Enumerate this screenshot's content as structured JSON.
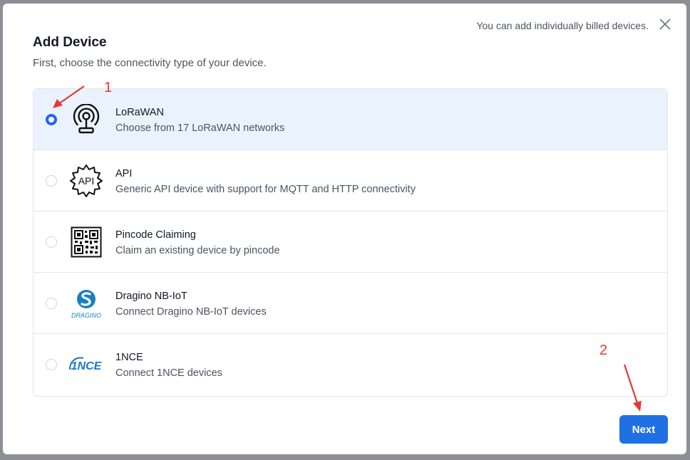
{
  "dialog": {
    "title": "Add Device",
    "subtitle": "First, choose the connectivity type of your device.",
    "hint": "You can add individually billed devices.",
    "close_icon": "close-icon",
    "next_label": "Next"
  },
  "options": [
    {
      "id": "lorawan",
      "title": "LoRaWAN",
      "description": "Choose from 17 LoRaWAN networks",
      "icon": "lorawan-antenna-icon",
      "selected": true
    },
    {
      "id": "api",
      "title": "API",
      "description": "Generic API device with support for MQTT and HTTP connectivity",
      "icon": "api-gear-icon",
      "selected": false
    },
    {
      "id": "pincode",
      "title": "Pincode Claiming",
      "description": "Claim an existing device by pincode",
      "icon": "qr-code-icon",
      "selected": false
    },
    {
      "id": "dragino",
      "title": "Dragino NB-IoT",
      "description": "Connect Dragino NB-IoT devices",
      "icon": "dragino-logo-icon",
      "selected": false
    },
    {
      "id": "1nce",
      "title": "1NCE",
      "description": "Connect 1NCE devices",
      "icon": "1nce-logo-icon",
      "selected": false
    }
  ],
  "logos": {
    "api_text": "API",
    "dragino_text": "DRAGINO",
    "one_nce_text": "1NCE"
  },
  "annotations": {
    "step1": "1",
    "step2": "2",
    "arrow_color": "#e53935"
  },
  "colors": {
    "accent": "#1f6fe5",
    "selected_bg": "#eaf3fd",
    "dragino_blue": "#1b7fc0",
    "nce_blue": "#1a78c2"
  }
}
